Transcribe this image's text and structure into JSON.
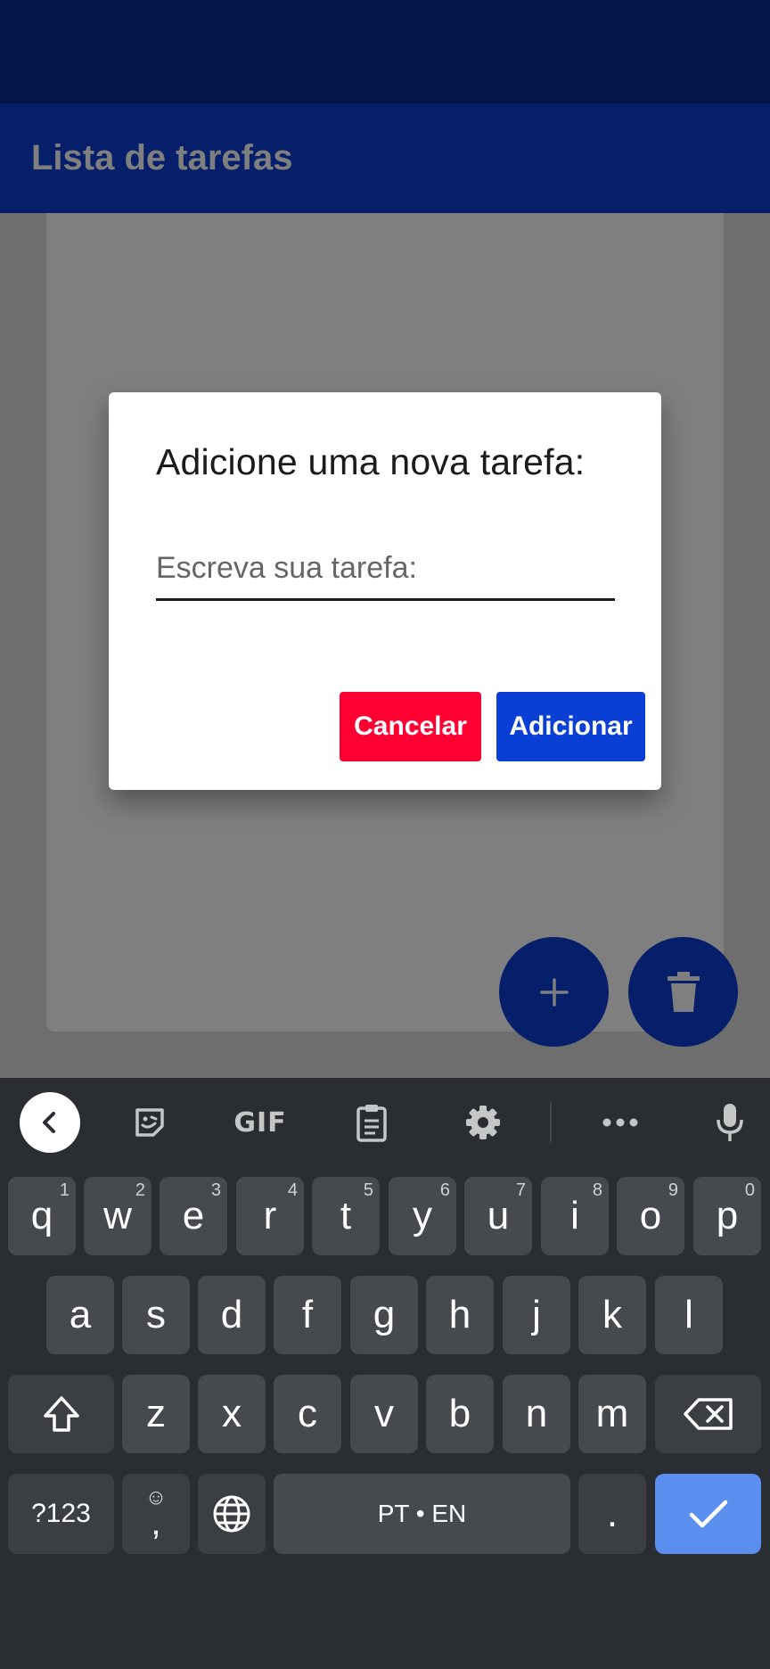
{
  "app": {
    "title": "Lista de tarefas",
    "colors": {
      "primary": "#0a3fd6",
      "danger": "#ff0033"
    }
  },
  "fabs": {
    "add_icon": "plus-icon",
    "delete_icon": "trash-icon"
  },
  "dialog": {
    "title": "Adicione uma nova tarefa:",
    "input_placeholder": "Escreva sua tarefa:",
    "input_value": "",
    "cancel_label": "Cancelar",
    "add_label": "Adicionar"
  },
  "keyboard": {
    "toolbar_icons": [
      "chevron-left-icon",
      "sticker-icon",
      "gif-icon",
      "clipboard-icon",
      "settings-icon",
      "more-icon",
      "mic-icon"
    ],
    "gif_label": "GIF",
    "row1": [
      {
        "key": "q",
        "hint": "1"
      },
      {
        "key": "w",
        "hint": "2"
      },
      {
        "key": "e",
        "hint": "3"
      },
      {
        "key": "r",
        "hint": "4"
      },
      {
        "key": "t",
        "hint": "5"
      },
      {
        "key": "y",
        "hint": "6"
      },
      {
        "key": "u",
        "hint": "7"
      },
      {
        "key": "i",
        "hint": "8"
      },
      {
        "key": "o",
        "hint": "9"
      },
      {
        "key": "p",
        "hint": "0"
      }
    ],
    "row2": [
      "a",
      "s",
      "d",
      "f",
      "g",
      "h",
      "j",
      "k",
      "l"
    ],
    "row3": [
      "z",
      "x",
      "c",
      "v",
      "b",
      "n",
      "m"
    ],
    "symbols_label": "?123",
    "comma_label": ",",
    "emoji_glyph": "☺",
    "space_label": "PT • EN",
    "period_label": "."
  }
}
